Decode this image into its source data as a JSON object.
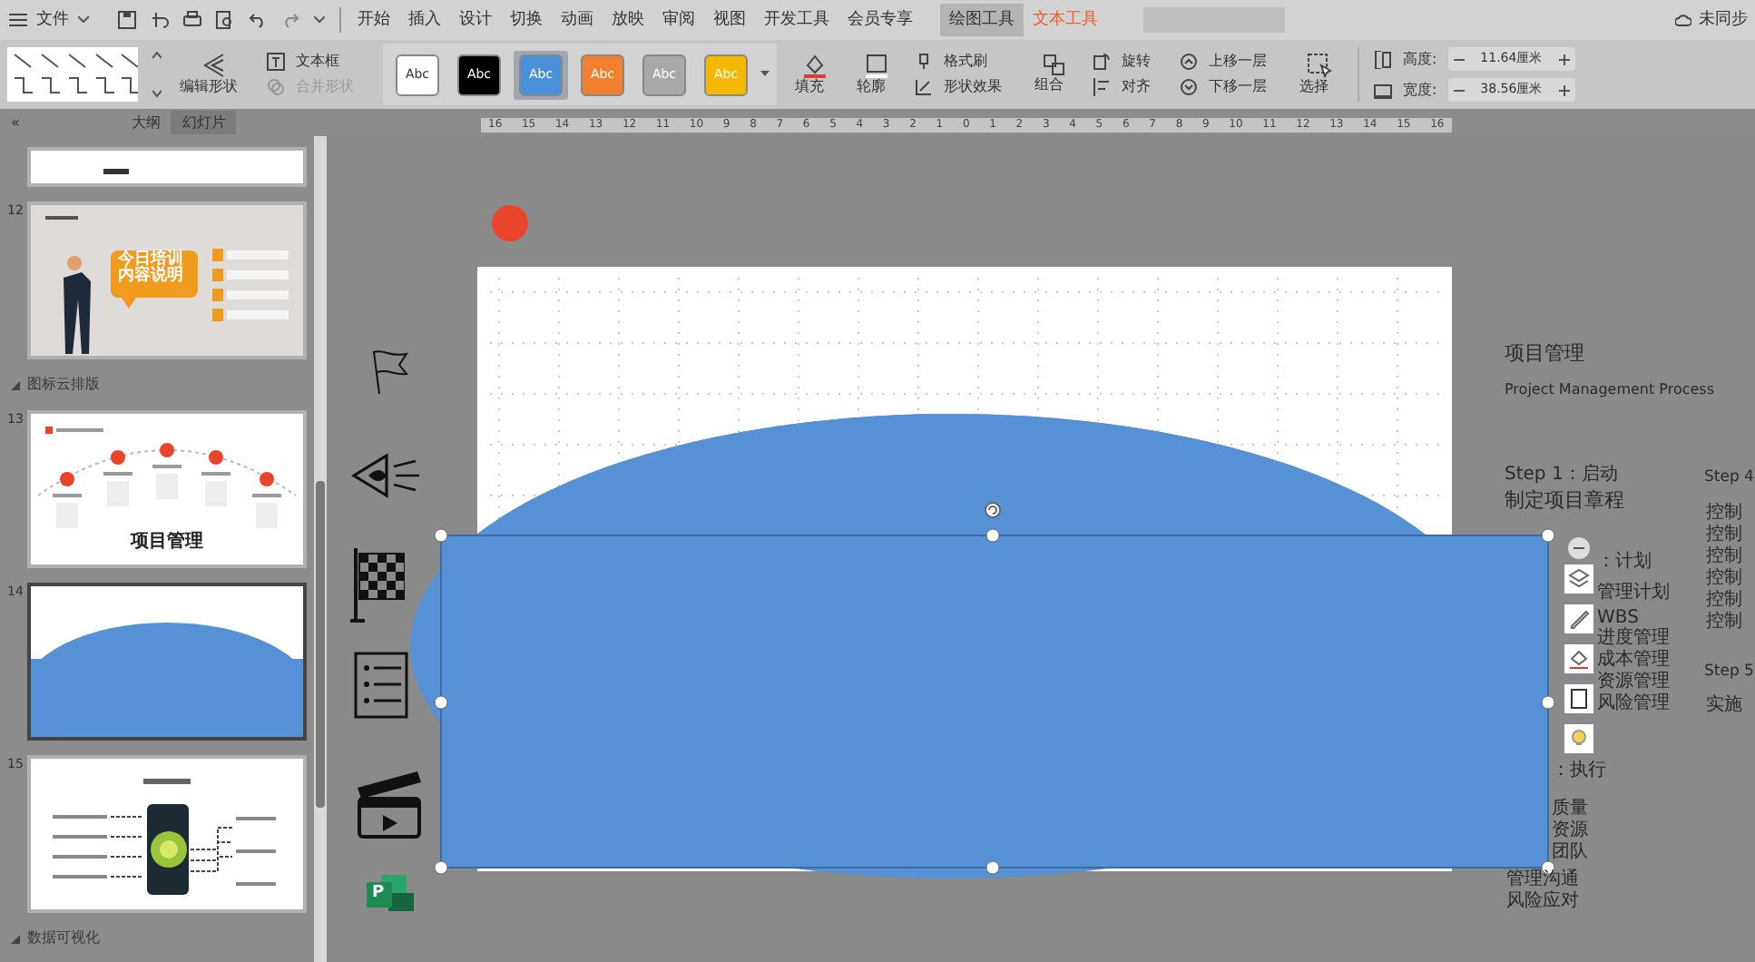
{
  "menu_bar": {
    "file_menu": "文件",
    "tabs": [
      {
        "label": "开始",
        "selected": false,
        "kind": "normal"
      },
      {
        "label": "插入",
        "selected": false,
        "kind": "normal"
      },
      {
        "label": "设计",
        "selected": false,
        "kind": "normal"
      },
      {
        "label": "切换",
        "selected": false,
        "kind": "normal"
      },
      {
        "label": "动画",
        "selected": false,
        "kind": "normal"
      },
      {
        "label": "放映",
        "selected": false,
        "kind": "normal"
      },
      {
        "label": "审阅",
        "selected": false,
        "kind": "normal"
      },
      {
        "label": "视图",
        "selected": false,
        "kind": "normal"
      },
      {
        "label": "开发工具",
        "selected": false,
        "kind": "normal"
      },
      {
        "label": "会员专享",
        "selected": false,
        "kind": "normal"
      },
      {
        "label": "绘图工具",
        "selected": true,
        "kind": "contextual"
      },
      {
        "label": "文本工具",
        "selected": false,
        "kind": "contextual"
      }
    ],
    "sync_status": "未同步"
  },
  "ribbon": {
    "edit_shape": "编辑形状",
    "text_box": "文本框",
    "merge_shapes": {
      "label": "合并形状",
      "disabled": true
    },
    "style_swatches": [
      {
        "label": "Abc",
        "color": "#ffffff",
        "selected": false
      },
      {
        "label": "Abc",
        "color": "#000000",
        "selected": false
      },
      {
        "label": "Abc",
        "color": "#4a90d9",
        "selected": true
      },
      {
        "label": "Abc",
        "color": "#f08030",
        "selected": false
      },
      {
        "label": "Abc",
        "color": "#a8a8a8",
        "selected": false
      },
      {
        "label": "Abc",
        "color": "#f5b800",
        "selected": false
      }
    ],
    "fill": "填充",
    "outline": "轮廓",
    "format_painter": "格式刷",
    "shape_effects": "形状效果",
    "group": "组合",
    "rotate": "旋转",
    "align": "对齐",
    "bring_forward": "上移一层",
    "send_backward": "下移一层",
    "select": "选择",
    "height": {
      "label": "高度:",
      "value": "11.64厘米"
    },
    "width": {
      "label": "宽度:",
      "value": "38.56厘米"
    }
  },
  "ruler": {
    "labels": [
      "16",
      "15",
      "14",
      "13",
      "12",
      "11",
      "10",
      "9",
      "8",
      "7",
      "6",
      "5",
      "4",
      "3",
      "2",
      "1",
      "0",
      "1",
      "2",
      "3",
      "4",
      "5",
      "6",
      "7",
      "8",
      "9",
      "10",
      "11",
      "12",
      "13",
      "14",
      "15",
      "16"
    ]
  },
  "slide_panel": {
    "collapse": "«",
    "tabs": [
      {
        "label": "大纲",
        "selected": false
      },
      {
        "label": "幻灯片",
        "selected": true
      }
    ],
    "items": [
      {
        "kind": "slide",
        "selected": false
      },
      {
        "kind": "slide",
        "number": "12",
        "selected": false,
        "title": [
          "今日培训",
          "内容说明"
        ]
      },
      {
        "kind": "section",
        "label": "图标云排版"
      },
      {
        "kind": "slide",
        "number": "13",
        "selected": false,
        "title": [
          "项目管理"
        ]
      },
      {
        "kind": "slide",
        "number": "14",
        "selected": true
      },
      {
        "kind": "slide",
        "number": "15",
        "selected": false
      },
      {
        "kind": "section",
        "label": "数据可视化"
      }
    ]
  },
  "canvas": {
    "app_icon_label": "P",
    "shapes": [
      {
        "kind": "ellipse",
        "selected": false
      },
      {
        "kind": "rectangle",
        "selected": true
      }
    ],
    "side_texts": [
      "项目管理",
      "Project Management Process",
      "Step 1：启动",
      "制定项目章程",
      "：计划",
      "管理计划",
      "WBS",
      "进度管理",
      "成本管理",
      "资源管理",
      "风险管理",
      "：执行",
      "质量",
      "资源",
      "团队",
      "管理沟通",
      "风险应对",
      "Step 4",
      "控制",
      "控制",
      "控制",
      "控制",
      "控制",
      "控制",
      "Step 5",
      "实施"
    ]
  }
}
